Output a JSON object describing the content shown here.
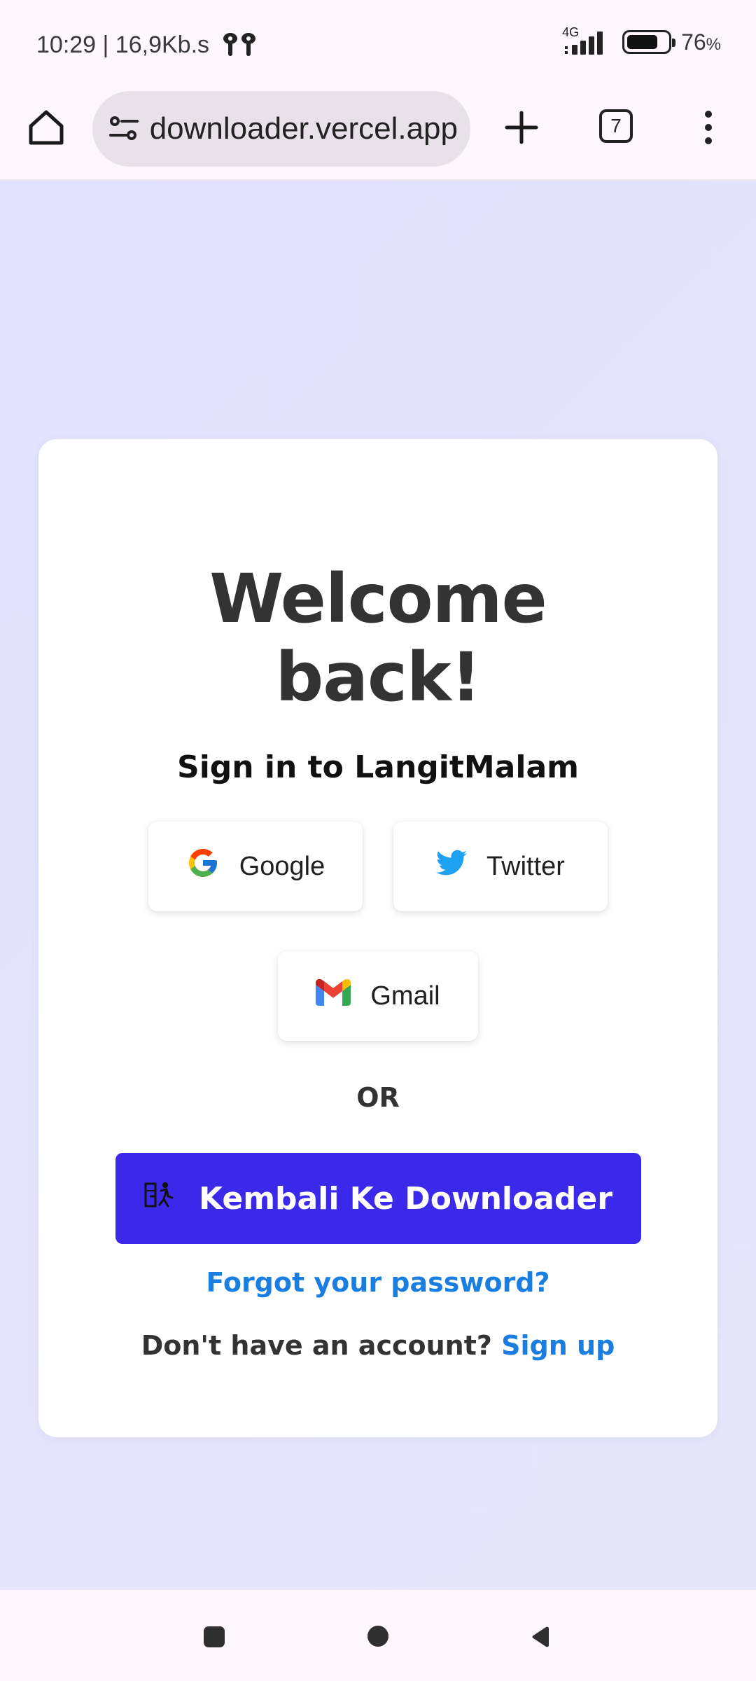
{
  "status_bar": {
    "time_speed": "10:29 | 16,9Kb.s",
    "network": "4G",
    "battery_level": "76",
    "battery_unit": "%",
    "battery_fraction": 0.76,
    "icons": [
      "earbuds-icon",
      "signal-icon",
      "battery-icon"
    ]
  },
  "browser": {
    "url": "downloader.vercel.app",
    "tab_count": "7",
    "icons": [
      "home-icon",
      "site-settings-icon",
      "new-tab-icon",
      "tab-switcher-icon",
      "more-menu-icon"
    ]
  },
  "card": {
    "title_line1": "Welcome",
    "title_line2": "back!",
    "subtitle": "Sign in to LangitMalam",
    "social": [
      {
        "label": "Google",
        "icon": "google-icon"
      },
      {
        "label": "Twitter",
        "icon": "twitter-icon"
      },
      {
        "label": "Gmail",
        "icon": "gmail-icon"
      }
    ],
    "divider": "OR",
    "primary_button": "Kembali Ke Downloader",
    "forgot_link": "Forgot your password?",
    "signup_prompt": "Don't have an account?",
    "signup_link": "Sign up"
  },
  "colors": {
    "primary": "#3a29ea",
    "link": "#1a7ee0",
    "background": "#e4e3fd"
  }
}
